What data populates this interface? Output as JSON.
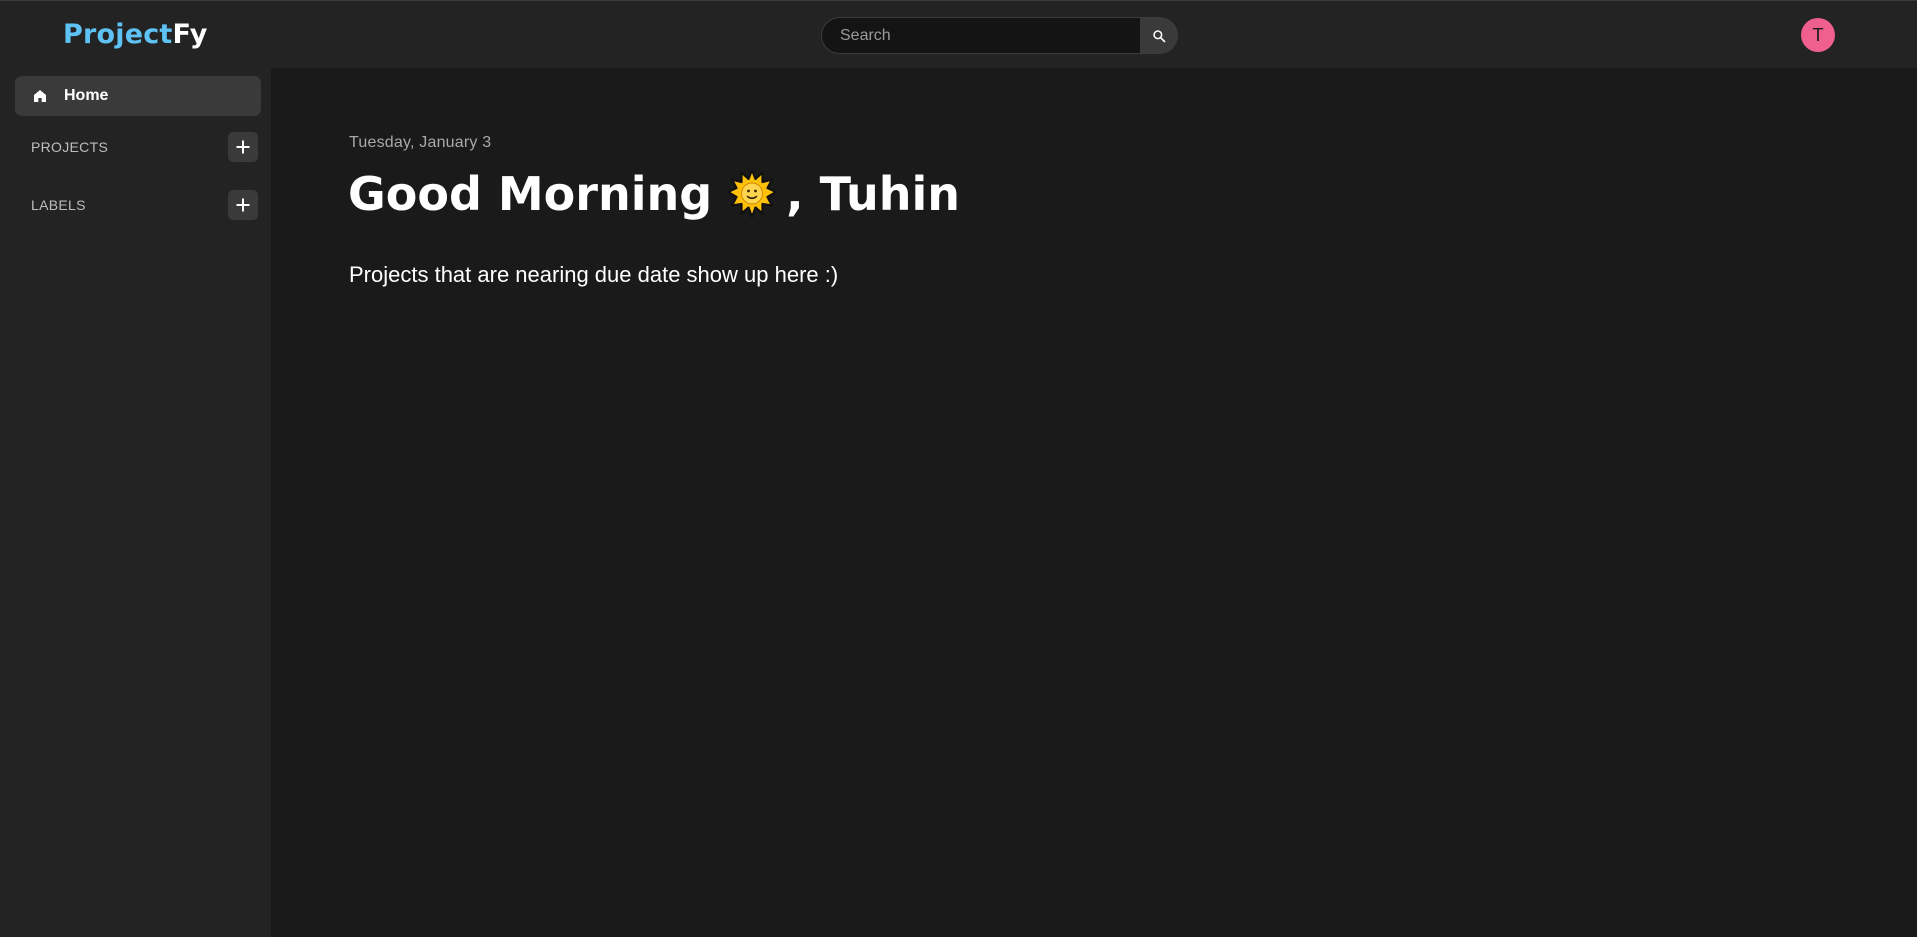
{
  "app": {
    "logo_part1": "Project",
    "logo_part2": "Fy",
    "brand_color": "#5ec3f4"
  },
  "header": {
    "search_placeholder": "Search",
    "search_icon": "search-icon",
    "avatar_initial": "T",
    "avatar_color": "#f0608e"
  },
  "sidebar": {
    "home_label": "Home",
    "home_icon": "home-icon",
    "sections": [
      {
        "title": "PROJECTS",
        "add_icon": "plus-icon"
      },
      {
        "title": "LABELS",
        "add_icon": "plus-icon"
      }
    ]
  },
  "main": {
    "date": "Tuesday, January 3",
    "greeting_start": "Good Morning",
    "greeting_icon": "sun-emoji-icon",
    "greeting_end": ", Tuhin",
    "empty_message": "Projects that are nearing due date show up here :)"
  }
}
